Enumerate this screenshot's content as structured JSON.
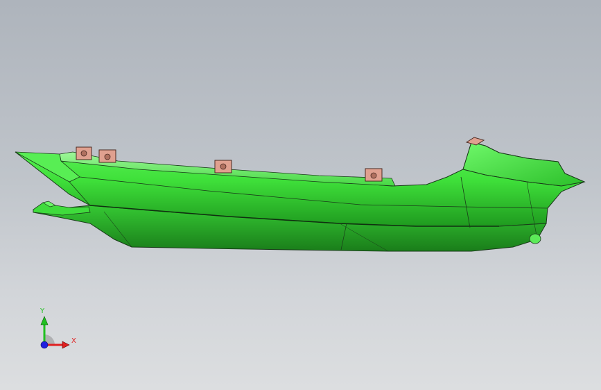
{
  "viewport": {
    "background_top": "#aeb4bc",
    "background_bottom": "#dcdee0"
  },
  "model": {
    "body_color": "#3fe03a",
    "body_shadow_color": "#22a322",
    "body_highlight_color": "#7ff07a",
    "edge_color": "#1a3a1a",
    "bracket_color": "#e0a08f",
    "bracket_edge_color": "#4a2a22"
  },
  "triad": {
    "x_label": "X",
    "y_label": "Y",
    "x_color": "#e02020",
    "y_color": "#20c020",
    "z_color": "#2020e0",
    "icon": "coordinate-triad-icon"
  }
}
